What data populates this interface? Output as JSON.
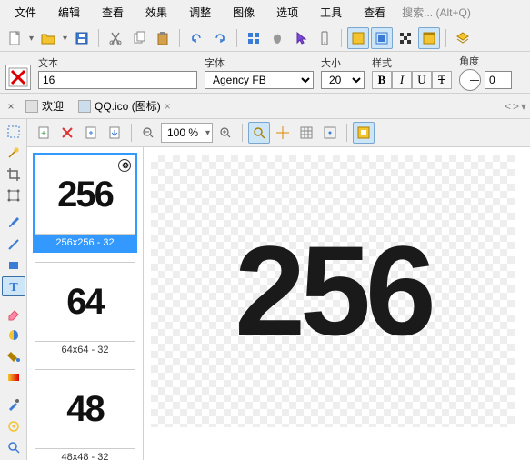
{
  "menu": {
    "file": "文件",
    "edit": "编辑",
    "view": "查看",
    "effect": "效果",
    "adjust": "调整",
    "image": "图像",
    "option": "选项",
    "tool": "工具",
    "search": "查看",
    "placeholder": "搜索... (Alt+Q)"
  },
  "options": {
    "text_label": "文本",
    "text_value": "16",
    "font_label": "字体",
    "font_value": "Agency FB",
    "size_label": "大小",
    "size_value": "20",
    "style_label": "样式",
    "angle_label": "角度",
    "angle_value": "0",
    "bold": "B",
    "italic": "I",
    "underline": "U",
    "strike": "T"
  },
  "tabs": {
    "welcome": "欢迎",
    "file": "QQ.ico (图标)",
    "close": "×",
    "left": "<",
    "right": ">",
    "more": "▾"
  },
  "zoom": {
    "value": "100 %"
  },
  "thumbs": [
    {
      "label": "256x256 - 32",
      "num": "256",
      "sel": true
    },
    {
      "label": "64x64 - 32",
      "num": "64",
      "sel": false
    },
    {
      "label": "48x48 - 32",
      "num": "48",
      "sel": false
    }
  ],
  "canvas": {
    "num": "256"
  },
  "icons": {
    "new": "new",
    "open": "open",
    "save": "save",
    "cut": "cut",
    "copy": "copy",
    "paste": "paste",
    "undo": "undo",
    "redo": "redo",
    "win": "win",
    "apple": "apple",
    "cursor": "cursor",
    "phone": "phone",
    "g1": "grid1",
    "g2": "grid2",
    "g3": "grid3",
    "g4": "grid4",
    "g5": "layers"
  }
}
